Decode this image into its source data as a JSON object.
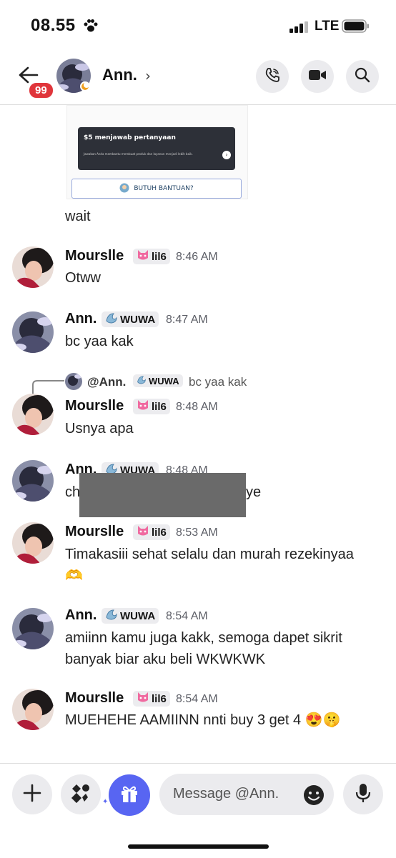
{
  "status_bar": {
    "time": "08.55",
    "network": "LTE"
  },
  "header": {
    "badge_count": "99",
    "name": "Ann.",
    "chevron": "›"
  },
  "embed_card": {
    "title": "$5 menjawab pertanyaan",
    "subtitle": "Jawaban Anda membantu membuat produk dan layanan menjadi lebih baik.",
    "button": "BUTUH BANTUAN?"
  },
  "messages": [
    {
      "text": "wait"
    },
    {
      "author": "Mourslle",
      "tag": "lil6",
      "time": "8:46 AM",
      "text": "Otww"
    },
    {
      "author": "Ann.",
      "tag": "WUWA",
      "time": "8:47 AM",
      "text": "bc yaa kak"
    },
    {
      "reply_to": "@Ann.",
      "reply_tag": "WUWA",
      "reply_text": "bc yaa kak",
      "author": "Mourslle",
      "tag": "lil6",
      "time": "8:48 AM",
      "text": "Usnya apa"
    },
    {
      "author": "Ann.",
      "tag": "WUWA",
      "time": "8:48 AM",
      "text_start": "ch",
      "text_end": "ye"
    },
    {
      "author": "Mourslle",
      "tag": "lil6",
      "time": "8:53 AM",
      "text": "Timakasiii sehat selalu dan murah rezekinyaa",
      "emoji": "🫶"
    },
    {
      "author": "Ann.",
      "tag": "WUWA",
      "time": "8:54 AM",
      "text": "amiinn kamu juga kakk, semoga dapet sikrit banyak biar aku beli WKWKWK"
    },
    {
      "author": "Mourslle",
      "tag": "lil6",
      "time": "8:54 AM",
      "text": "MUEHEHE AAMIINN nnti buy 3 get 4 😍🤫"
    }
  ],
  "composer": {
    "placeholder": "Message @Ann."
  },
  "colors": {
    "accent": "#5865f2",
    "badge": "#e0353b",
    "redaction": "#6a6a6a"
  }
}
